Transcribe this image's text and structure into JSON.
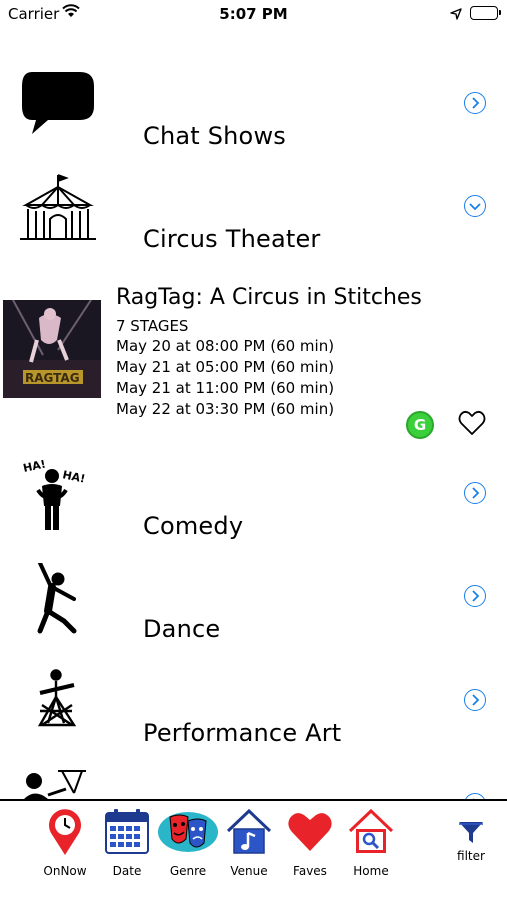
{
  "status_bar": {
    "carrier": "Carrier",
    "time": "5:07 PM"
  },
  "genres": [
    {
      "label": "Chat Shows",
      "icon": "speech-bubble-icon",
      "expanded": false
    },
    {
      "label": "Circus Theater",
      "icon": "circus-tent-icon",
      "expanded": true
    },
    {
      "label": "Comedy",
      "icon": "laughing-figure-icon",
      "expanded": false
    },
    {
      "label": "Dance",
      "icon": "dancer-icon",
      "expanded": false
    },
    {
      "label": "Performance Art",
      "icon": "performance-art-icon",
      "expanded": false
    }
  ],
  "show": {
    "title": "RagTag: A Circus in Stitches",
    "venue": "7 STAGES",
    "times": [
      "May 20 at 08:00 PM (60 min)",
      "May 21 at 05:00 PM (60 min)",
      "May 21 at 11:00 PM (60 min)",
      "May 22 at 03:30 PM (60 min)"
    ],
    "rating_badge": "G",
    "badge_color": "#3ccf3c"
  },
  "tabbar": {
    "tabs": [
      {
        "label": "OnNow",
        "icon": "map-pin-clock-icon"
      },
      {
        "label": "Date",
        "icon": "calendar-icon"
      },
      {
        "label": "Genre",
        "icon": "theater-masks-icon",
        "selected": true
      },
      {
        "label": "Venue",
        "icon": "house-music-note-icon"
      },
      {
        "label": "Faves",
        "icon": "heart-icon"
      },
      {
        "label": "Home",
        "icon": "house-search-icon"
      }
    ],
    "filter_label": "filter"
  },
  "colors": {
    "accent_blue": "#1a7fe8",
    "selected_tab_bg": "#2ab6c8",
    "heart_red": "#e8242a"
  }
}
